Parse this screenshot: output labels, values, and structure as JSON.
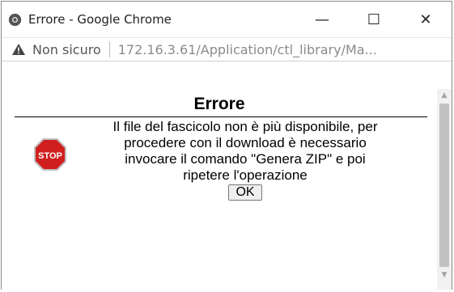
{
  "window": {
    "title": "Errore - Google Chrome",
    "minimize_label": "—",
    "maximize_label": "☐",
    "close_label": "✕"
  },
  "address": {
    "security_label": "Non sicuro",
    "url": "172.16.3.61/Application/ctl_library/Ma..."
  },
  "dialog": {
    "title": "Errore",
    "message_lines": [
      "Il file del fascicolo non è più disponibile, per",
      "procedere con il download è necessario",
      "invocare il comando \"Genera ZIP\" e poi",
      "ripetere l'operazione"
    ],
    "ok_label": "OK",
    "stop_sign_text": "STOP"
  },
  "colors": {
    "stop_red": "#d11f1f",
    "scroll_thumb": "#c1c1c1"
  }
}
